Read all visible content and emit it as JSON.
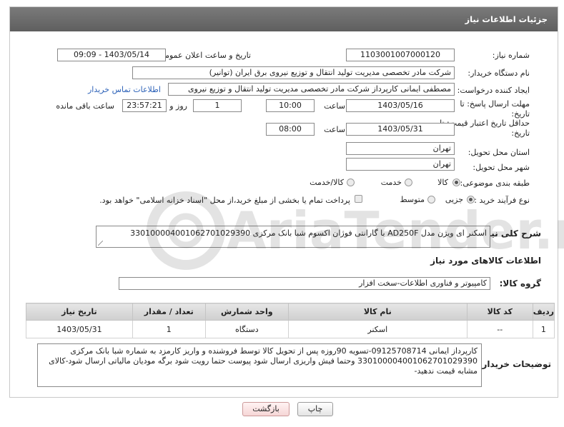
{
  "header": {
    "title": "جزئیات اطلاعات نیاز"
  },
  "fields": {
    "need_number": {
      "label": "شماره نیاز:",
      "value": "1103001007000120"
    },
    "announce_datetime": {
      "label": "تاریخ و ساعت اعلان عمومی:",
      "value": "1403/05/14 - 09:09"
    },
    "buyer_org": {
      "label": "نام دستگاه خریدار:",
      "value": "شرکت مادر تخصصی مدیریت تولید  انتقال و توزیع نیروی برق ایران (توانیر)"
    },
    "requester": {
      "label": "ایجاد کننده درخواست:",
      "value": "مصطفی ایمانی کارپرداز شرکت مادر تخصصی مدیریت تولید  انتقال و توزیع نیروی",
      "contact_link": "اطلاعات تماس خریدار"
    },
    "deadline": {
      "label_line1": "مهلت ارسال پاسخ: تا",
      "label_line2": "تاریخ:",
      "date": "1403/05/16",
      "time_label": "ساعت",
      "time": "10:00",
      "days": "1",
      "days_label": "روز و",
      "remaining": "23:57:21",
      "remaining_label": "ساعت باقی مانده"
    },
    "price_validity": {
      "label_line1": "حداقل تاریخ اعتبار قیمت: تا",
      "label_line2": "تاریخ:",
      "date": "1403/05/31",
      "time_label": "ساعت",
      "time": "08:00"
    },
    "province": {
      "label": "استان محل تحویل:",
      "value": "تهران"
    },
    "city": {
      "label": "شهر محل تحویل:",
      "value": "تهران"
    },
    "category": {
      "label": "طبقه بندی موضوعی:",
      "options": [
        "کالا",
        "خدمت",
        "کالا/خدمت"
      ],
      "selected": "کالا"
    },
    "process": {
      "label": "نوع فرآیند خرید :",
      "options": [
        "جزیی",
        "متوسط"
      ],
      "selected": "جزیی",
      "treasury_note": "پرداخت تمام یا بخشی از مبلغ خرید،از محل \"اسناد خزانه اسلامی\" خواهد بود."
    }
  },
  "description": {
    "label": "شرح کلی نیاز:",
    "value": "اسکنر ای ویژن مدل AD250F با گارانتی فوژان اکسوم شبا بانک مرکزی 330100004001062701029390"
  },
  "goods_section": {
    "title": "اطلاعات کالاهای مورد نیاز",
    "group_label": "گروه کالا:",
    "group_value": "کامپیوتر و فناوری اطلاعات-سخت افزار"
  },
  "table": {
    "headers": [
      "ردیف",
      "کد کالا",
      "نام کالا",
      "واحد شمارش",
      "تعداد / مقدار",
      "تاریخ نیاز"
    ],
    "rows": [
      [
        "1",
        "--",
        "اسکنر",
        "دستگاه",
        "1",
        "1403/05/31"
      ]
    ]
  },
  "buyer_notes": {
    "label": "توضیحات خریدار:",
    "value": "کارپرداز ایمانی 09125708714-تسویه 90روزه پس از تحویل کالا توسط فروشنده و واریز کارمزد به شماره شبا بانک مرکزی 330100004001062701029390 وحتما فیش واریزی ارسال شود پیوست حتما رویت شود برگه مودیان مالیاتی ارسال شود-کالای مشابه قیمت ندهید-"
  },
  "buttons": {
    "print": "چاپ",
    "back": "بازگشت"
  },
  "watermark": {
    "text": "AriaTender.neT"
  }
}
